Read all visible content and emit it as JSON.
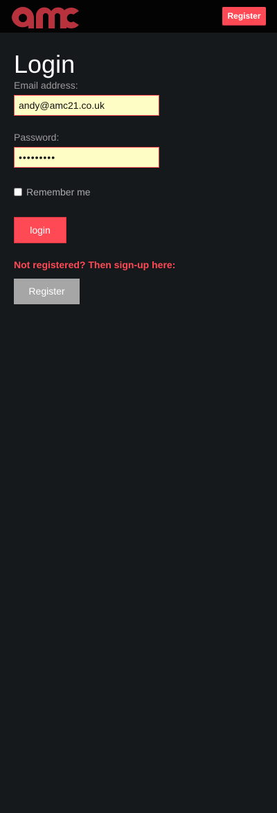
{
  "navbar": {
    "logo_icon": "amc-logo-icon",
    "register_label": "Register"
  },
  "login": {
    "title": "Login",
    "email_label": "Email address:",
    "email_value": "andy@amc21.co.uk",
    "password_label": "Password:",
    "password_value": "aaaaaaaaa",
    "remember_label": "Remember me",
    "remember_checked": false,
    "login_label": "login",
    "signup_prompt": "Not registered? Then sign-up here:",
    "register_label": "Register"
  },
  "colors": {
    "accent": "#ff4a55",
    "background": "#16191c",
    "navbar": "#030303",
    "input_background": "#fdfdc5",
    "secondary_button": "#a6a6a6"
  }
}
